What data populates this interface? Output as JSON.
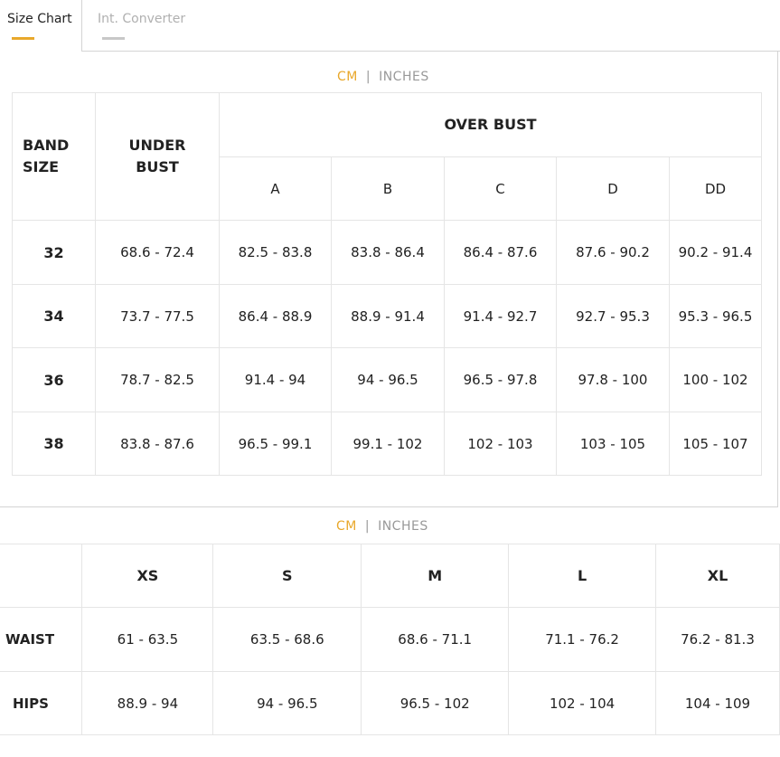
{
  "colors": {
    "accent": "#E9A82B",
    "inactive_underline": "#c8c8c8"
  },
  "tabs": [
    {
      "label": "Size Chart",
      "active": true
    },
    {
      "label": "Int. Converter",
      "active": false
    }
  ],
  "units": {
    "active": "CM",
    "separator": "|",
    "inactive": "INCHES"
  },
  "bra_table": {
    "band_header": "BAND SIZE",
    "under_header": "UNDER BUST",
    "over_header": "OVER BUST",
    "cups": [
      "A",
      "B",
      "C",
      "D",
      "DD"
    ],
    "rows": [
      {
        "band": "32",
        "under": "68.6 - 72.4",
        "cups": [
          "82.5 - 83.8",
          "83.8 - 86.4",
          "86.4 - 87.6",
          "87.6 - 90.2",
          "90.2 - 91.4"
        ]
      },
      {
        "band": "34",
        "under": "73.7 - 77.5",
        "cups": [
          "86.4 - 88.9",
          "88.9 - 91.4",
          "91.4 - 92.7",
          "92.7 - 95.3",
          "95.3 - 96.5"
        ]
      },
      {
        "band": "36",
        "under": "78.7 - 82.5",
        "cups": [
          "91.4 - 94",
          "94 - 96.5",
          "96.5 - 97.8",
          "97.8 - 100",
          "100 - 102"
        ]
      },
      {
        "band": "38",
        "under": "83.8 - 87.6",
        "cups": [
          "96.5 - 99.1",
          "99.1 - 102",
          "102 - 103",
          "103 - 105",
          "105 - 107"
        ]
      }
    ]
  },
  "bottom_table": {
    "sizes": [
      "XS",
      "S",
      "M",
      "L",
      "XL"
    ],
    "rows": [
      {
        "label": "WAIST",
        "values": [
          "61 - 63.5",
          "63.5 - 68.6",
          "68.6 - 71.1",
          "71.1 - 76.2",
          "76.2 - 81.3"
        ]
      },
      {
        "label": "HIPS",
        "values": [
          "88.9 - 94",
          "94 - 96.5",
          "96.5 - 102",
          "102 - 104",
          "104 - 109"
        ]
      }
    ]
  }
}
